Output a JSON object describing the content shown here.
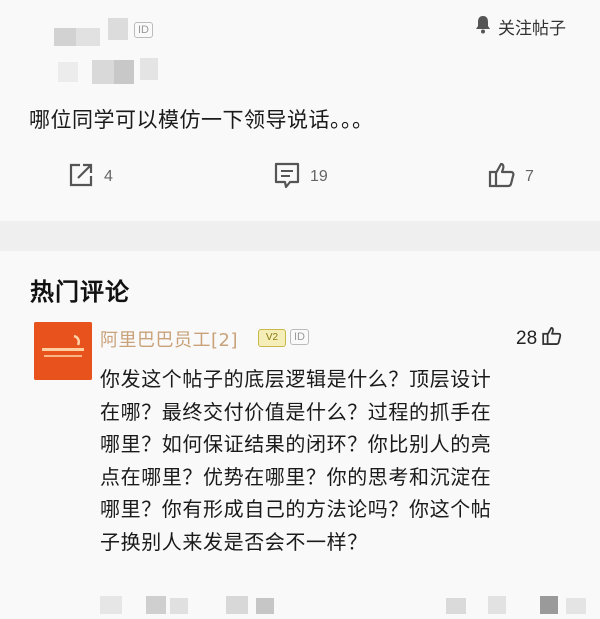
{
  "post": {
    "author_badge": "ID",
    "follow_label": "关注帖子",
    "content": "哪位同学可以模仿一下领导说话。。。",
    "actions": {
      "share_count": "4",
      "comment_count": "19",
      "like_count": "7"
    }
  },
  "hot_comments": {
    "title": "热门评论",
    "comment": {
      "username": "阿里巴巴员工[2]",
      "level_badge": "V2",
      "id_badge": "ID",
      "likes": "28",
      "text": "你发这个帖子的底层逻辑是什么？顶层设计\n在哪？最终交付价值是什么？过程的抓手在\n哪里？如何保证结果的闭环？你比别人的亮\n点在哪里？优势在哪里？你的思考和沉淀在\n哪里？你有形成自己的方法论吗？你这个帖\n子换别人来发是否会不一样？",
      "avatar_color": "#e8521d"
    }
  },
  "icons": [
    "bell-icon",
    "share-icon",
    "comment-icon",
    "thumbs-up-icon"
  ],
  "colors": {
    "background": "#f9f9f9",
    "divider": "#efefef",
    "username": "#c9a27a"
  }
}
